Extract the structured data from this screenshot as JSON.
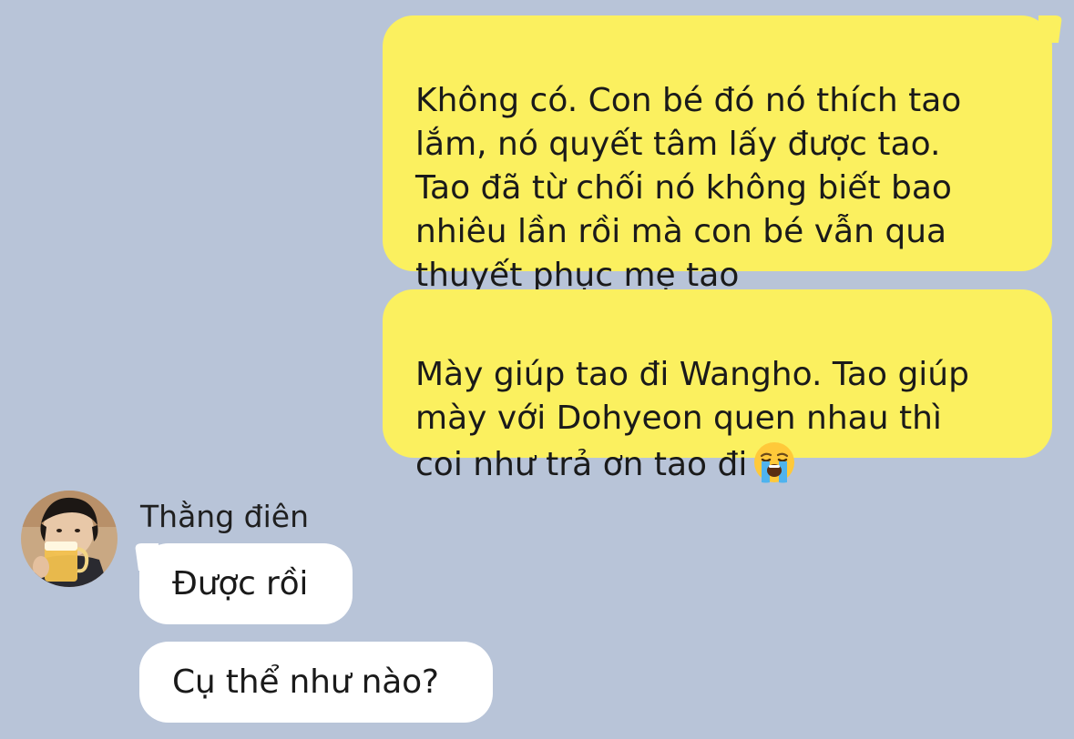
{
  "conversation": {
    "contact_name": "Thằng điên",
    "outgoing_messages": [
      {
        "text": "Không có. Con bé đó nó thích tao\nlắm, nó quyết tâm lấy được tao.\nTao đã từ chối nó không biết bao\nnhiêu lần rồi mà con bé vẫn qua\nthuyết phục mẹ tao"
      },
      {
        "text": "Mày giúp tao đi Wangho. Tao giúp\nmày với Dohyeon quen nhau thì\ncoi như trả ơn tao đi",
        "emoji": "loudly-crying-face-emoji"
      }
    ],
    "incoming_messages": [
      {
        "text": "Được rồi"
      },
      {
        "text": "Cụ thể như nào?"
      }
    ]
  },
  "colors": {
    "background": "#b8c4d8",
    "outgoing_bubble": "#fbf05f",
    "incoming_bubble": "#ffffff",
    "text": "#1a1a1a"
  }
}
